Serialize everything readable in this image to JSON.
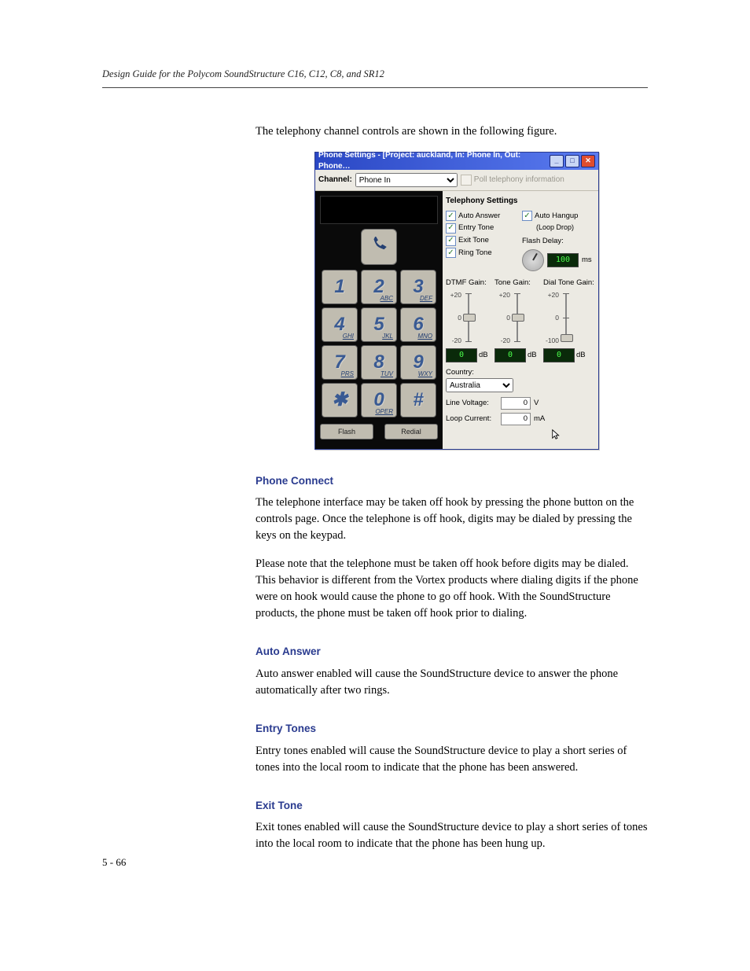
{
  "header": {
    "running": "Design Guide for the Polycom SoundStructure C16, C12, C8, and SR12"
  },
  "intro": "The telephony channel controls are shown in the following figure.",
  "figure": {
    "title": "Phone Settings - [Project: auckland, In: Phone In, Out: Phone…",
    "channel_label": "Channel:",
    "channel_value": "Phone In",
    "poll_label": "Poll telephony information",
    "group_title": "Telephony Settings",
    "left_checks": {
      "auto_answer": "Auto Answer",
      "entry_tone": "Entry Tone",
      "exit_tone": "Exit Tone",
      "ring_tone": "Ring Tone"
    },
    "right_col": {
      "auto_hangup": "Auto Hangup",
      "loop_drop": "(Loop Drop)",
      "flash_delay": "Flash Delay:",
      "flash_delay_value": "100",
      "flash_delay_unit": "ms"
    },
    "gain": {
      "dtmf": {
        "label": "DTMF Gain:",
        "top": "+20",
        "mid": "0",
        "bot": "-20",
        "value": "0",
        "unit": "dB"
      },
      "tone": {
        "label": "Tone Gain:",
        "top": "+20",
        "mid": "0",
        "bot": "-20",
        "value": "0",
        "unit": "dB"
      },
      "dial": {
        "label": "Dial Tone Gain:",
        "top": "+20",
        "mid": "0",
        "bot": "-100",
        "value": "0",
        "unit": "dB"
      }
    },
    "country_label": "Country:",
    "country_value": "Australia",
    "line_voltage_label": "Line Voltage:",
    "line_voltage_value": "0",
    "line_voltage_unit": "V",
    "loop_current_label": "Loop Current:",
    "loop_current_value": "0",
    "loop_current_unit": "mA",
    "flash_btn": "Flash",
    "redial_btn": "Redial",
    "keys": {
      "k1": {
        "d": "1",
        "l": ""
      },
      "k2": {
        "d": "2",
        "l": "ABC"
      },
      "k3": {
        "d": "3",
        "l": "DEF"
      },
      "k4": {
        "d": "4",
        "l": "GHI"
      },
      "k5": {
        "d": "5",
        "l": "JKL"
      },
      "k6": {
        "d": "6",
        "l": "MNO"
      },
      "k7": {
        "d": "7",
        "l": "PRS"
      },
      "k8": {
        "d": "8",
        "l": "TUV"
      },
      "k9": {
        "d": "9",
        "l": "WXY"
      },
      "kstar": {
        "d": "✱",
        "l": ""
      },
      "k0": {
        "d": "0",
        "l": "OPER"
      },
      "khash": {
        "d": "#",
        "l": ""
      }
    }
  },
  "sections": {
    "phone_connect": {
      "title": "Phone Connect",
      "p1": "The telephone interface may be taken off hook by pressing the phone button on the controls page. Once the telephone is off hook, digits may be dialed by pressing the keys on the keypad.",
      "p2": "Please note that the telephone must be taken off hook before digits may be dialed. This behavior is different from the Vortex products where dialing digits if the phone were on hook would cause the phone to go off hook. With the SoundStructure products, the phone must be taken off hook prior to dialing."
    },
    "auto_answer": {
      "title": "Auto Answer",
      "p1": "Auto answer enabled will cause the SoundStructure device to answer the phone automatically after two rings."
    },
    "entry_tones": {
      "title": "Entry Tones",
      "p1": "Entry tones enabled will cause the SoundStructure device to play a short series of tones into the local room to indicate that the phone has been answered."
    },
    "exit_tone": {
      "title": "Exit Tone",
      "p1": "Exit tones enabled will cause the SoundStructure device to play a short series of tones into the local room to indicate that the phone has been hung up."
    }
  },
  "footer": {
    "page": "5 - 66"
  }
}
